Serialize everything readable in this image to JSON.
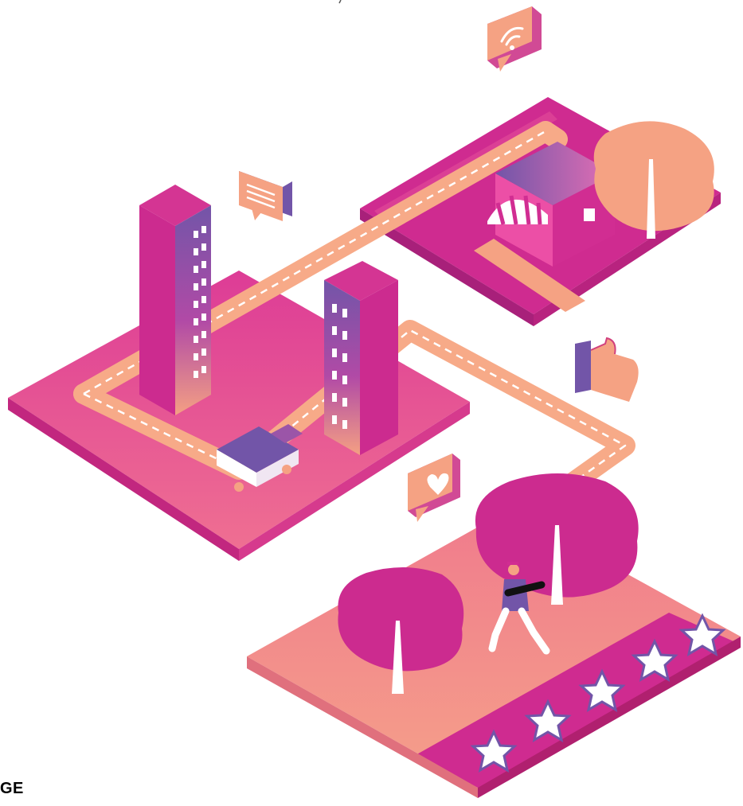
{
  "corner_label": "GE",
  "colors": {
    "magenta": "#d12d92",
    "pink": "#e8589a",
    "salmon": "#f5a283",
    "purple": "#7255a8",
    "white": "#ffffff"
  },
  "icons": [
    "wifi-chat-icon",
    "message-chat-icon",
    "thumbs-up-icon",
    "heart-chat-icon",
    "star-icon"
  ],
  "rating": {
    "stars": 5,
    "max": 5
  }
}
